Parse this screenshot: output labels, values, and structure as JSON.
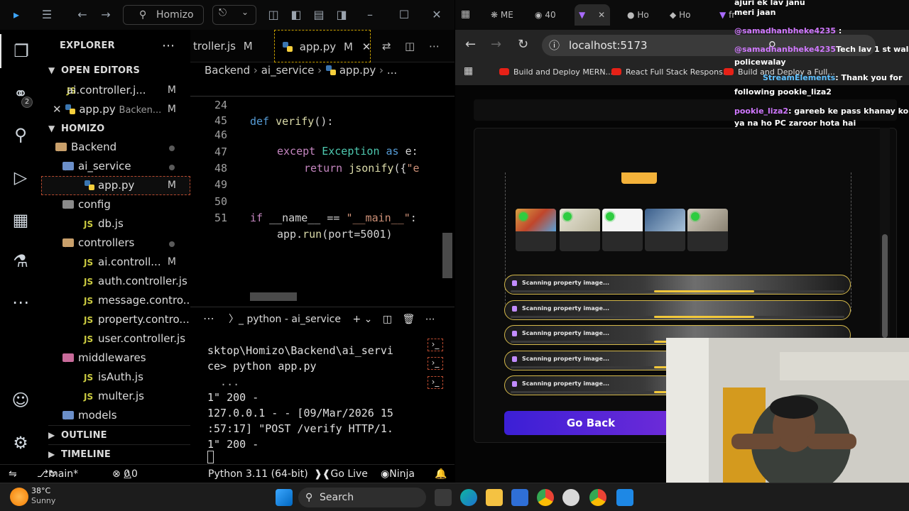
{
  "vscode": {
    "titlebar": {
      "search": "Homizo"
    },
    "explorer": {
      "title": "EXPLORER",
      "open_editors_label": "OPEN EDITORS",
      "open_editors": [
        {
          "name": "ai.controller.j...",
          "status": "M"
        },
        {
          "name": "app.py",
          "path": "Backen...",
          "status": "M"
        }
      ],
      "workspace": "HOMIZO",
      "tree": [
        {
          "name": "Backend",
          "kind": "folder"
        },
        {
          "name": "ai_service",
          "kind": "folder"
        },
        {
          "name": "app.py",
          "kind": "py",
          "status": "M"
        },
        {
          "name": "config",
          "kind": "folder"
        },
        {
          "name": "db.js",
          "kind": "js"
        },
        {
          "name": "controllers",
          "kind": "folder"
        },
        {
          "name": "ai.controll...",
          "kind": "js",
          "status": "M"
        },
        {
          "name": "auth.controller.js",
          "kind": "js"
        },
        {
          "name": "message.contro...",
          "kind": "js"
        },
        {
          "name": "property.contro...",
          "kind": "js"
        },
        {
          "name": "user.controller.js",
          "kind": "js"
        },
        {
          "name": "middlewares",
          "kind": "folder"
        },
        {
          "name": "isAuth.js",
          "kind": "js"
        },
        {
          "name": "multer.js",
          "kind": "js"
        },
        {
          "name": "models",
          "kind": "folder"
        }
      ],
      "outline_label": "OUTLINE",
      "timeline_label": "TIMELINE"
    },
    "activity_badge": "2",
    "tabs": [
      {
        "label": "troller.js",
        "status": "M"
      },
      {
        "label": "app.py",
        "status": "M"
      }
    ],
    "breadcrumb": {
      "a": "Backend",
      "b": "ai_service",
      "c": "app.py",
      "d": "..."
    },
    "code": {
      "l24": {
        "n": "24",
        "kw": "def",
        "fn": "verify",
        "rest": "():"
      },
      "l45": {
        "n": "45"
      },
      "l46": {
        "n": "46",
        "kw": "except",
        "cls": "Exception",
        "as": "as",
        "rest": "e:"
      },
      "l47": {
        "n": "47",
        "kw": "return",
        "fn": "jsonify",
        "rest": "({",
        "str": "\"e"
      },
      "l48": {
        "n": "48"
      },
      "l49": {
        "n": "49"
      },
      "l50": {
        "n": "50",
        "kw": "if",
        "a": "__name__",
        "op": "==",
        "str": "\"__main__\"",
        "rest": ":"
      },
      "l51": {
        "n": "51",
        "a": "app.",
        "fn": "run",
        "rest": "(port=5001)"
      }
    },
    "terminal": {
      "title": "python - ai_service",
      "lines": [
        "sktop\\Homizo\\Backend\\ai_servi",
        "ce> python app.py",
        "  ...",
        "1\" 200 -",
        "127.0.0.1 - - [09/Mar/2026 15",
        ":57:17] \"POST /verify HTTP/1.",
        "1\" 200 -"
      ]
    },
    "status": {
      "branch": "main*",
      "errors": "0",
      "warnings": "0",
      "python": "Python 3.11 (64-bit)",
      "golive": "Go Live",
      "ninja": "Ninja"
    }
  },
  "browser": {
    "tabs": [
      {
        "label": "ME"
      },
      {
        "label": "40"
      },
      {
        "label": ""
      },
      {
        "label": "Ho"
      },
      {
        "label": "Ho"
      },
      {
        "label": "fr"
      }
    ],
    "url": "localhost:5173",
    "bookmarks": [
      {
        "label": "Build and Deploy MERN..."
      },
      {
        "label": "React Full Stack Respons..."
      },
      {
        "label": "Build and Deploy a Full..."
      }
    ],
    "page": {
      "scan_label": "Scanning property image...",
      "scan_rows": [
        {
          "progress": 0.3
        },
        {
          "progress": 0.3
        },
        {
          "progress": 0.05
        },
        {
          "progress": 0.05
        },
        {
          "progress": 0.05
        }
      ],
      "go_back": "Go Back"
    }
  },
  "chat": [
    {
      "user": "",
      "msg": "ajuri ek lav janu"
    },
    {
      "user": "",
      "msg": "meri jaan"
    },
    {
      "user": "@samadhanbheke4235",
      "msg": ":"
    },
    {
      "user": "@samadhanbheke4235",
      "msg": "Tech lav 1 st wala"
    },
    {
      "user": "",
      "msg": "policewalay"
    },
    {
      "user": "StreamElements",
      "msg": ": Thank you for"
    },
    {
      "user": "",
      "msg": "following pookie_liza2"
    },
    {
      "user": "pookie_liza2",
      "msg": ": gareeb ke pass khanay ko ho"
    },
    {
      "user": "",
      "msg": "ya na ho PC zaroor hota hai"
    }
  ],
  "taskbar": {
    "weather_temp": "38°C",
    "weather_desc": "Sunny",
    "search": "Search"
  }
}
